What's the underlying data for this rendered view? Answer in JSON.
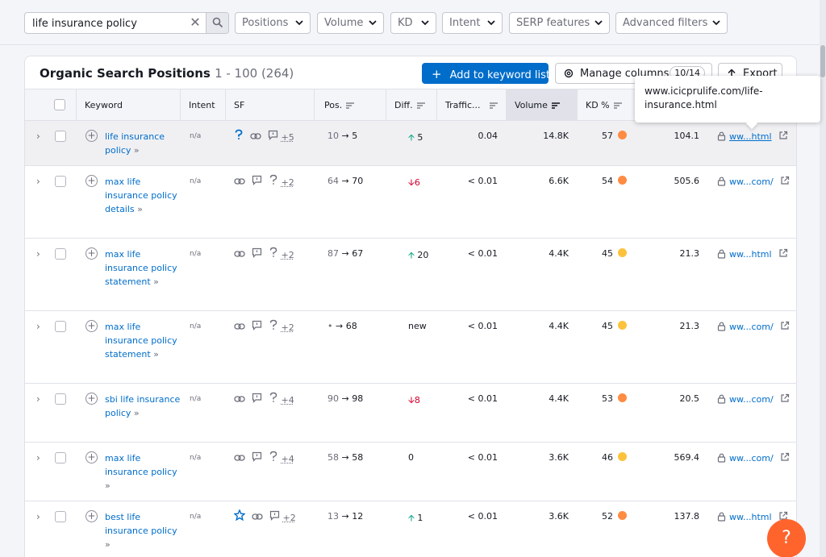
{
  "search": {
    "value": "life insurance policy"
  },
  "filters": [
    "Positions",
    "Volume",
    "KD",
    "Intent",
    "SERP features",
    "Advanced filters"
  ],
  "card": {
    "title": "Organic Search Positions",
    "range": "1 - 100 (264)",
    "add_button": "Add to keyword list",
    "manage_button": "Manage columns",
    "manage_badge": "10/14",
    "export_button": "Export"
  },
  "columns": {
    "keyword": "Keyword",
    "intent": "Intent",
    "sf": "SF",
    "pos": "Pos.",
    "diff": "Diff.",
    "traffic": "Traffic...",
    "volume": "Volume",
    "kd": "KD %"
  },
  "tooltip": "www.icicprulife.com/life-insurance.html",
  "rows": [
    {
      "keyword": "life insurance policy",
      "intent": "n/a",
      "sf_more": "+5",
      "pos_from": "10",
      "pos_to": "5",
      "diff": "5",
      "diff_dir": "up",
      "traffic": "0.04",
      "volume": "14.8K",
      "kd": "57",
      "kd_color": "#ff8c43",
      "cpc": "104.1",
      "url": "ww...html"
    },
    {
      "keyword": "max life insurance policy details",
      "intent": "n/a",
      "sf_more": "+2",
      "pos_from": "64",
      "pos_to": "70",
      "diff": "6",
      "diff_dir": "down",
      "traffic": "< 0.01",
      "volume": "6.6K",
      "kd": "54",
      "kd_color": "#ff8c43",
      "cpc": "505.6",
      "url": "ww...com/"
    },
    {
      "keyword": "max life insurance policy statement",
      "intent": "n/a",
      "sf_more": "+2",
      "pos_from": "87",
      "pos_to": "67",
      "diff": "20",
      "diff_dir": "up",
      "traffic": "< 0.01",
      "volume": "4.4K",
      "kd": "45",
      "kd_color": "#fdc23c",
      "cpc": "21.3",
      "url": "ww...html"
    },
    {
      "keyword": "max life insurance policy statement",
      "intent": "n/a",
      "sf_more": "+2",
      "pos_from": "•",
      "pos_to": "68",
      "diff": "new",
      "diff_dir": "none",
      "traffic": "< 0.01",
      "volume": "4.4K",
      "kd": "45",
      "kd_color": "#fdc23c",
      "cpc": "21.3",
      "url": "ww...com/"
    },
    {
      "keyword": "sbi life insurance policy",
      "intent": "n/a",
      "sf_more": "+4",
      "pos_from": "90",
      "pos_to": "98",
      "diff": "8",
      "diff_dir": "down",
      "traffic": "< 0.01",
      "volume": "4.4K",
      "kd": "53",
      "kd_color": "#ff8c43",
      "cpc": "20.5",
      "url": "ww...com/"
    },
    {
      "keyword": "max life insurance policy",
      "intent": "n/a",
      "sf_more": "+4",
      "pos_from": "58",
      "pos_to": "58",
      "diff": "0",
      "diff_dir": "none",
      "traffic": "< 0.01",
      "volume": "3.6K",
      "kd": "46",
      "kd_color": "#fdc23c",
      "cpc": "569.4",
      "url": "ww...com/"
    },
    {
      "keyword": "best life insurance policy",
      "intent": "n/a",
      "sf_more": "+2",
      "pos_from": "13",
      "pos_to": "12",
      "diff": "1",
      "diff_dir": "up",
      "traffic": "< 0.01",
      "volume": "3.6K",
      "kd": "52",
      "kd_color": "#ff8c43",
      "cpc": "137.8",
      "url": "ww...html"
    }
  ]
}
